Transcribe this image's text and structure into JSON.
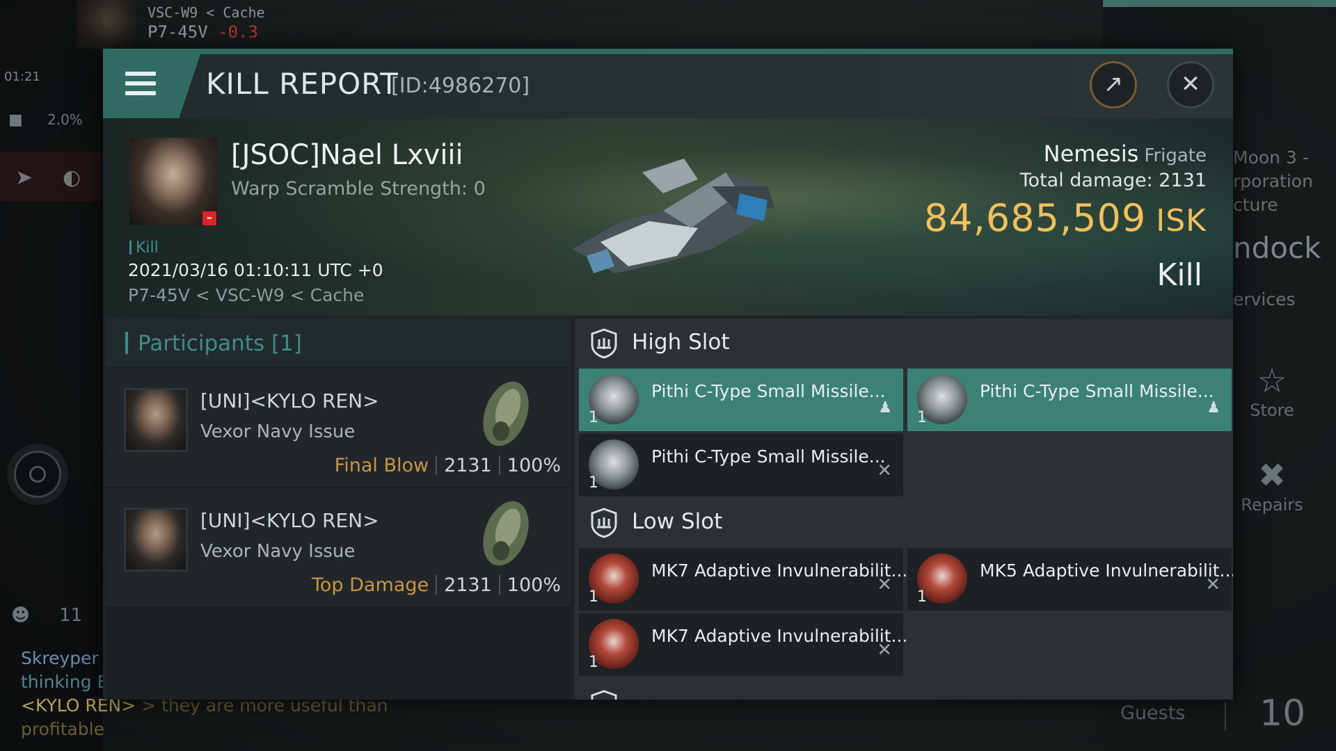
{
  "background": {
    "location_route": "VSC-W9 < Cache",
    "location_system": "P7-45V",
    "location_security": "-0.3",
    "clock": "01:21",
    "cargo_percent": "2.0%",
    "chat_member_count": "11",
    "chat_lines": [
      {
        "name": "Skreyper",
        "text": "thinking E"
      },
      {
        "name": "<KYLO REN>",
        "text": "> they are more useful than profitable"
      }
    ],
    "station_menu": {
      "line1": "Moon 3 -",
      "line2": "rporation",
      "line3": "cture",
      "undock": "ndock",
      "services": "ervices"
    },
    "side_buttons": [
      {
        "icon": "nes-star-icon",
        "label": "Store"
      },
      {
        "icon": "wrench-screwdriver-icon",
        "label": "Repairs"
      }
    ],
    "guests_label": "Guests",
    "guests_count": "10"
  },
  "window": {
    "title": "KILL REPORT",
    "id": "[ID:4986270]"
  },
  "victim": {
    "name": "[JSOC]Nael Lxviii",
    "warp_scramble": "Warp Scramble Strength: 0",
    "tag": "Kill",
    "timestamp": "2021/03/16 01:10:11 UTC +0",
    "location": "P7-45V < VSC-W9 < Cache",
    "ship": "Nemesis",
    "ship_class": "Frigate",
    "total_damage_label": "Total damage:",
    "total_damage": "2131",
    "isk_value": "84,685,509",
    "isk_unit": "ISK",
    "result": "Kill"
  },
  "participants": {
    "title": "Participants [1]",
    "rows": [
      {
        "name": "[UNI]<KYLO REN>",
        "ship": "Vexor Navy Issue",
        "role": "Final Blow",
        "damage": "2131",
        "percent": "100%"
      },
      {
        "name": "[UNI]<KYLO REN>",
        "ship": "Vexor Navy Issue",
        "role": "Top Damage",
        "damage": "2131",
        "percent": "100%"
      }
    ]
  },
  "fitting": {
    "high_slot_label": "High Slot",
    "low_slot_label": "Low Slot",
    "high_slot": [
      {
        "name": "Pithi C-Type Small Missile...",
        "qty": "1",
        "status": "dropped"
      },
      {
        "name": "Pithi C-Type Small Missile...",
        "qty": "1",
        "status": "dropped"
      },
      {
        "name": "Pithi C-Type Small Missile...",
        "qty": "1",
        "status": "destroyed"
      }
    ],
    "low_slot": [
      {
        "name": "MK7 Adaptive Invulnerabilit...",
        "qty": "1",
        "status": "destroyed"
      },
      {
        "name": "MK5 Adaptive Invulnerabilit...",
        "qty": "1",
        "status": "destroyed"
      },
      {
        "name": "MK7 Adaptive Invulnerabilit...",
        "qty": "1",
        "status": "destroyed"
      }
    ]
  },
  "colors": {
    "accent": "#3f8e84",
    "isk": "#f2c05a",
    "role": "#c8963e",
    "dropped_bg": "#3b8275",
    "victim_badge": "#d9262a"
  }
}
